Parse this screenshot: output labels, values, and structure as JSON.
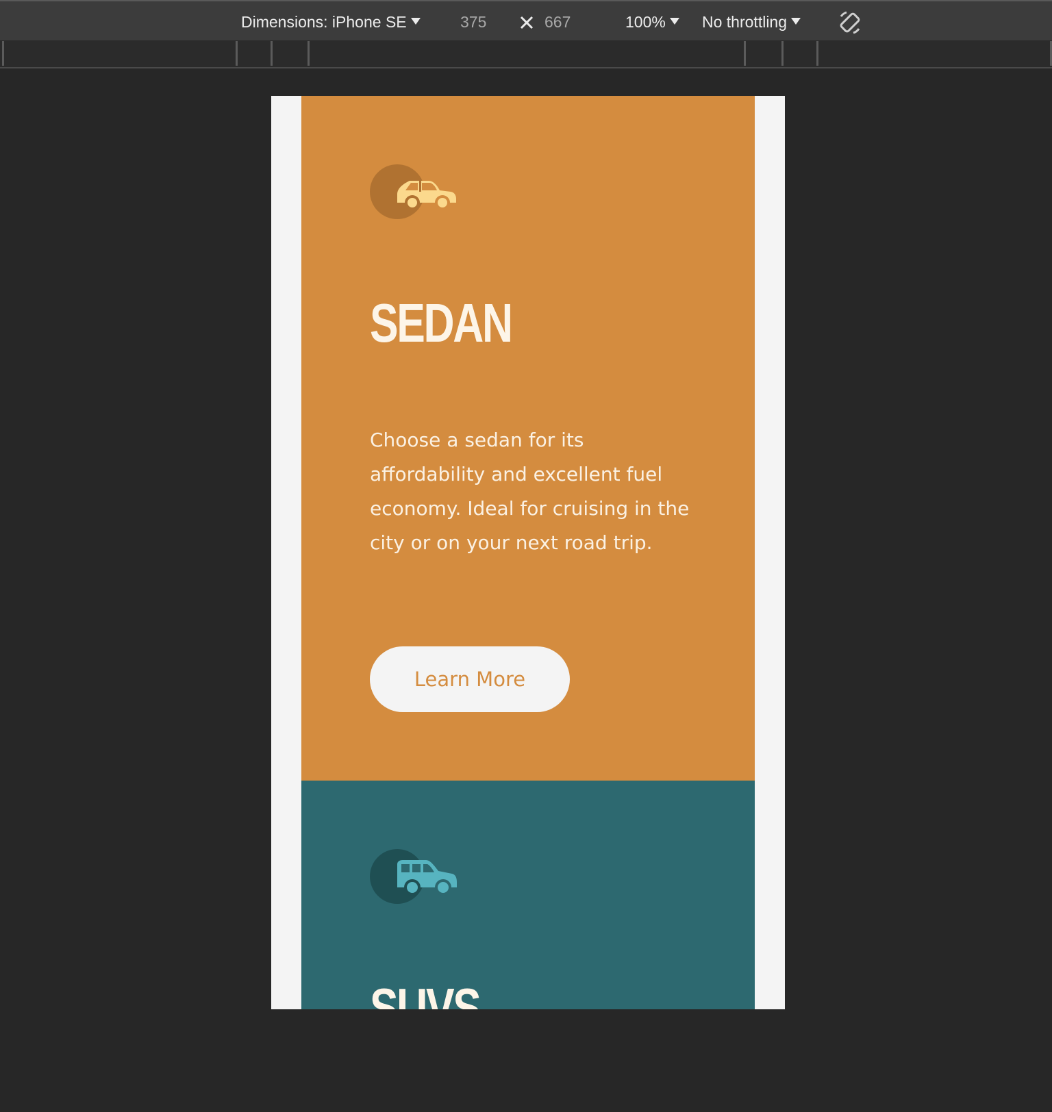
{
  "toolbar": {
    "dimensions_label": "Dimensions: iPhone SE",
    "width_value": "375",
    "height_value": "667",
    "zoom": "100%",
    "throttling": "No throttling"
  },
  "colors": {
    "sedan_bg": "#d48c3f",
    "suvs_bg": "#2d6970",
    "page_bg": "#f4f4f4"
  },
  "cards": {
    "sedan": {
      "icon": "sedan-car-icon",
      "title": "SEDAN",
      "text": "Choose a sedan for its affordability and excellent fuel economy. Ideal for cruising in the city or on your next road trip.",
      "button": "Learn More"
    },
    "suvs": {
      "icon": "suv-car-icon",
      "title": "SUVS"
    }
  }
}
